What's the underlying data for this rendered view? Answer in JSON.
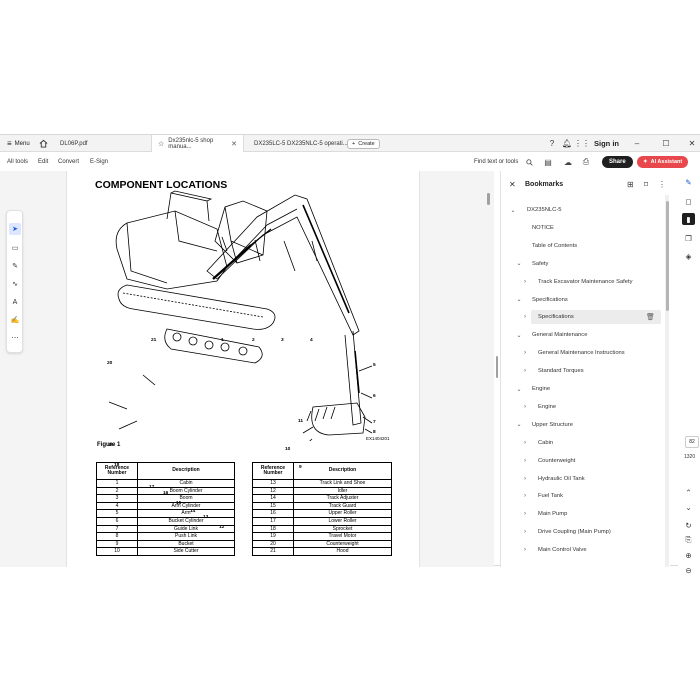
{
  "tabbar": {
    "menu_label": "Menu",
    "tabs": [
      {
        "label": "DL06P.pdf"
      },
      {
        "label": "Dx235nlc-5 shop manua..."
      },
      {
        "label": "DX235LC-5 DX235NLC-5 operati..."
      }
    ],
    "new_tab_label": "Create",
    "sign_in_label": "Sign in"
  },
  "toolbar": {
    "menus": [
      "All tools",
      "Edit",
      "Convert",
      "E-Sign"
    ],
    "find_label": "Find text or tools",
    "share_label": "Share",
    "ai_label": "AI Assistant"
  },
  "document": {
    "title": "COMPONENT LOCATIONS",
    "figure_label": "Figure 1",
    "figure_code": "EX1404201",
    "callouts": [
      "1",
      "2",
      "3",
      "4",
      "5",
      "6",
      "7",
      "8",
      "9",
      "10",
      "11",
      "12",
      "13",
      "14",
      "15",
      "16",
      "17",
      "18",
      "19",
      "20",
      "21"
    ],
    "table_header": {
      "number": "Reference Number",
      "description": "Description"
    },
    "left_rows": [
      {
        "n": "1",
        "d": "Cabin"
      },
      {
        "n": "2",
        "d": "Boom Cylinder"
      },
      {
        "n": "3",
        "d": "Boom"
      },
      {
        "n": "4",
        "d": "Arm Cylinder"
      },
      {
        "n": "5",
        "d": "Arm"
      },
      {
        "n": "6",
        "d": "Bucket Cylinder"
      },
      {
        "n": "7",
        "d": "Guide Link"
      },
      {
        "n": "8",
        "d": "Push Link"
      },
      {
        "n": "9",
        "d": "Bucket"
      },
      {
        "n": "10",
        "d": "Side Cutter"
      }
    ],
    "right_rows": [
      {
        "n": "13",
        "d": "Track Link and Shoe"
      },
      {
        "n": "12",
        "d": "Idler"
      },
      {
        "n": "14",
        "d": "Track Adjuster"
      },
      {
        "n": "15",
        "d": "Track Guard"
      },
      {
        "n": "16",
        "d": "Upper Roller"
      },
      {
        "n": "17",
        "d": "Lower Roller"
      },
      {
        "n": "18",
        "d": "Sprocket"
      },
      {
        "n": "19",
        "d": "Travel Motor"
      },
      {
        "n": "20",
        "d": "Counterweight"
      },
      {
        "n": "21",
        "d": "Hood"
      }
    ]
  },
  "bookmarks": {
    "title": "Bookmarks",
    "items": [
      {
        "label": "DX235NLC-5",
        "level": 0,
        "chevron": "down"
      },
      {
        "label": "NOTICE",
        "level": 1,
        "chevron": ""
      },
      {
        "label": "Table of Contents",
        "level": 1,
        "chevron": ""
      },
      {
        "label": "Safety",
        "level": 1,
        "chevron": "down"
      },
      {
        "label": "Track Excavator Maintenance Safety",
        "level": 2,
        "chevron": "right"
      },
      {
        "label": "Specifications",
        "level": 1,
        "chevron": "down"
      },
      {
        "label": "Specifications",
        "level": 2,
        "chevron": "right",
        "selected": true
      },
      {
        "label": "General Maintenance",
        "level": 1,
        "chevron": "down"
      },
      {
        "label": "General Maintenance Instructions",
        "level": 2,
        "chevron": "right"
      },
      {
        "label": "Standard Torques",
        "level": 2,
        "chevron": "right"
      },
      {
        "label": "Engine",
        "level": 1,
        "chevron": "down"
      },
      {
        "label": "Engine",
        "level": 2,
        "chevron": "right"
      },
      {
        "label": "Upper Structure",
        "level": 1,
        "chevron": "down"
      },
      {
        "label": "Cabin",
        "level": 2,
        "chevron": "right"
      },
      {
        "label": "Counterweight",
        "level": 2,
        "chevron": "right"
      },
      {
        "label": "Hydraulic Oil Tank",
        "level": 2,
        "chevron": "right"
      },
      {
        "label": "Fuel Tank",
        "level": 2,
        "chevron": "right"
      },
      {
        "label": "Main Pump",
        "level": 2,
        "chevron": "right"
      },
      {
        "label": "Drive Coupling (Main Pump)",
        "level": 2,
        "chevron": "right"
      },
      {
        "label": "Main Control Valve",
        "level": 2,
        "chevron": "right"
      }
    ]
  },
  "pagination": {
    "current": "82",
    "total": "1320"
  },
  "colors": {
    "accent": "#1a56d6",
    "ai": "#e8474c",
    "share": "#1f1f1f"
  }
}
